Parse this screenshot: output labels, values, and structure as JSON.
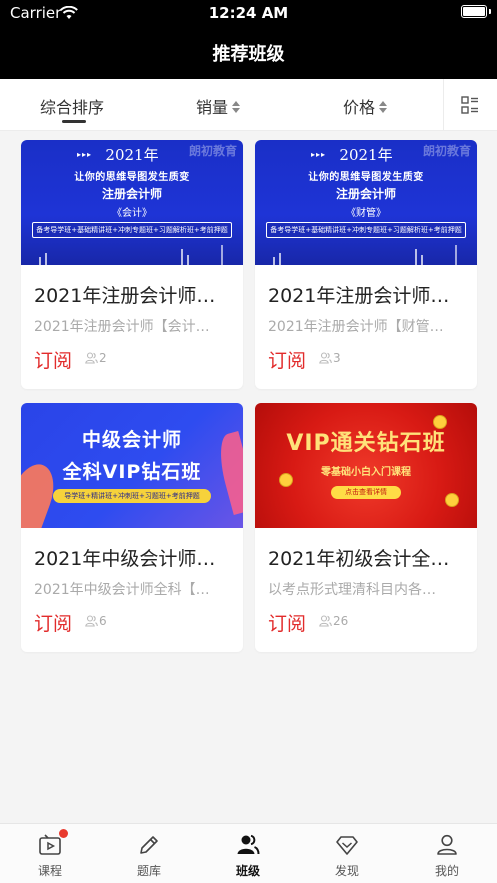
{
  "status_bar": {
    "carrier": "Carrier",
    "time": "12:24 AM"
  },
  "nav": {
    "title": "推荐班级"
  },
  "filters": {
    "comprehensive": "综合排序",
    "sales": "销量",
    "price": "价格",
    "layout_icon": "list-layout-icon"
  },
  "courses": [
    {
      "title": "2021年注册会计师…",
      "subtitle": "2021年注册会计师【会计…",
      "price": "订阅",
      "students": "2",
      "thumb": {
        "year": "2021年",
        "brand": "朗初教育",
        "line1": "让你的思维导图发生质变",
        "line2": "注册会计师",
        "line3": "《会计》",
        "band": "备考导学班+基础精讲班+冲刺专题班+习题解析班+考前押题"
      }
    },
    {
      "title": "2021年注册会计师…",
      "subtitle": "2021年注册会计师【财管…",
      "price": "订阅",
      "students": "3",
      "thumb": {
        "year": "2021年",
        "brand": "朗初教育",
        "line1": "让你的思维导图发生质变",
        "line2": "注册会计师",
        "line3": "《财管》",
        "band": "备考导学班+基础精讲班+冲刺专题班+习题解析班+考前押题"
      }
    },
    {
      "title": "2021年中级会计师…",
      "subtitle": "2021年中级会计师全科【…",
      "price": "订阅",
      "students": "6",
      "thumb": {
        "line1": "中级会计师",
        "line2": "全科VIP钻石班",
        "band": "导学班+精讲班+冲刺班+习题班+考前押题"
      }
    },
    {
      "title": "2021年初级会计全…",
      "subtitle": "以考点形式理清科目内各…",
      "price": "订阅",
      "students": "26",
      "thumb": {
        "line1": "VIP通关钻石班",
        "line2": "零基础小白入门课程",
        "button": "点击查看详情"
      }
    }
  ],
  "tabs": [
    {
      "label": "课程",
      "icon": "video-icon",
      "badge": true
    },
    {
      "label": "题库",
      "icon": "pencil-icon"
    },
    {
      "label": "班级",
      "icon": "group-icon",
      "active": true
    },
    {
      "label": "发现",
      "icon": "diamond-icon"
    },
    {
      "label": "我的",
      "icon": "person-icon"
    }
  ],
  "colors": {
    "price": "#e22b2b",
    "nav_bg": "#000000"
  }
}
